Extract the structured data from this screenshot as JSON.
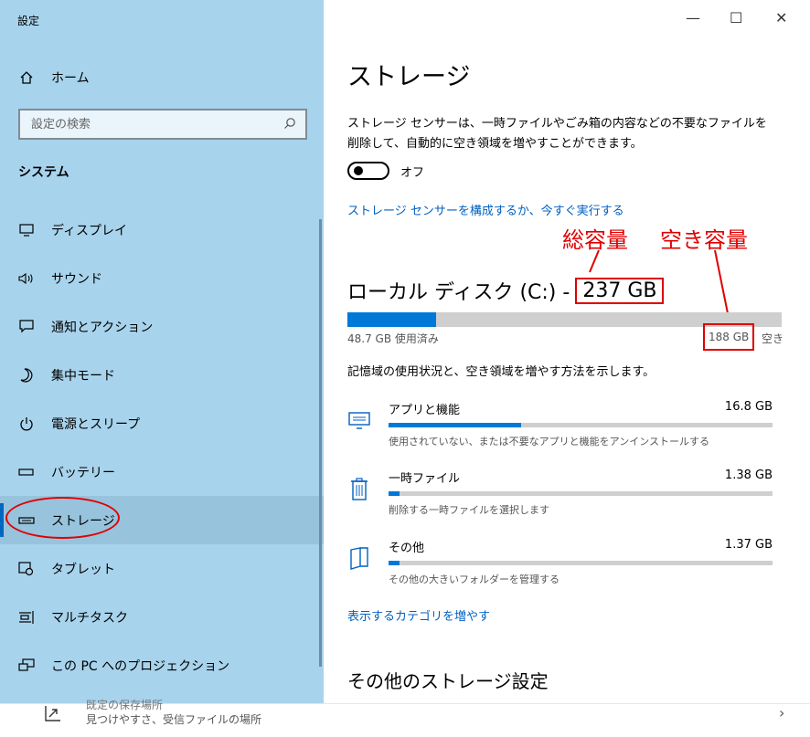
{
  "window": {
    "title": "設定",
    "minimize": "—",
    "maximize": "☐",
    "close": "✕"
  },
  "sidebar": {
    "home_label": "ホーム",
    "search_placeholder": "設定の検索",
    "section": "システム",
    "items": [
      {
        "label": "ディスプレイ",
        "icon": "monitor-icon"
      },
      {
        "label": "サウンド",
        "icon": "speaker-icon"
      },
      {
        "label": "通知とアクション",
        "icon": "notification-icon"
      },
      {
        "label": "集中モード",
        "icon": "moon-icon"
      },
      {
        "label": "電源とスリープ",
        "icon": "power-icon"
      },
      {
        "label": "バッテリー",
        "icon": "battery-icon"
      },
      {
        "label": "ストレージ",
        "icon": "storage-icon",
        "selected": true
      },
      {
        "label": "タブレット",
        "icon": "tablet-icon"
      },
      {
        "label": "マルチタスク",
        "icon": "multitask-icon"
      },
      {
        "label": "この PC へのプロジェクション",
        "icon": "projection-icon"
      }
    ]
  },
  "main": {
    "title": "ストレージ",
    "description": "ストレージ センサーは、一時ファイルやごみ箱の内容などの不要なファイルを削除して、自動的に空き領域を増やすことができます。",
    "toggle_state": "オフ",
    "configure_link": "ストレージ センサーを構成するか、今すぐ実行する",
    "disk": {
      "name": "ローカル ディスク (C:) -",
      "total": "237 GB",
      "used_label": "48.7 GB 使用済み",
      "free": "188 GB",
      "free_suffix": "空き",
      "used_fraction": 0.205
    },
    "storage_desc": "記憶域の使用状況と、空き領域を増やす方法を示します。",
    "categories": [
      {
        "name": "アプリと機能",
        "size": "16.8 GB",
        "sub": "使用されていない、または不要なアプリと機能をアンインストールする",
        "fraction": 0.345,
        "icon": "apps-icon"
      },
      {
        "name": "一時ファイル",
        "size": "1.38 GB",
        "sub": "削除する一時ファイルを選択します",
        "fraction": 0.028,
        "icon": "trash-icon"
      },
      {
        "name": "その他",
        "size": "1.37 GB",
        "sub": "その他の大きいフォルダーを管理する",
        "fraction": 0.028,
        "icon": "folder-icon"
      }
    ],
    "more_categories": "表示するカテゴリを増やす",
    "other_settings": "その他のストレージ設定"
  },
  "annotations": {
    "total_label": "総容量",
    "free_label": "空き容量",
    "color": "#e00000"
  },
  "bottom_strip": {
    "title": "既定の保存場所",
    "subtitle": "見つけやすさ、受信ファイルの場所",
    "chevron": "›"
  },
  "colors": {
    "sidebar": "#a8d3ec",
    "accent": "#0078d7",
    "link": "#0060c0"
  }
}
